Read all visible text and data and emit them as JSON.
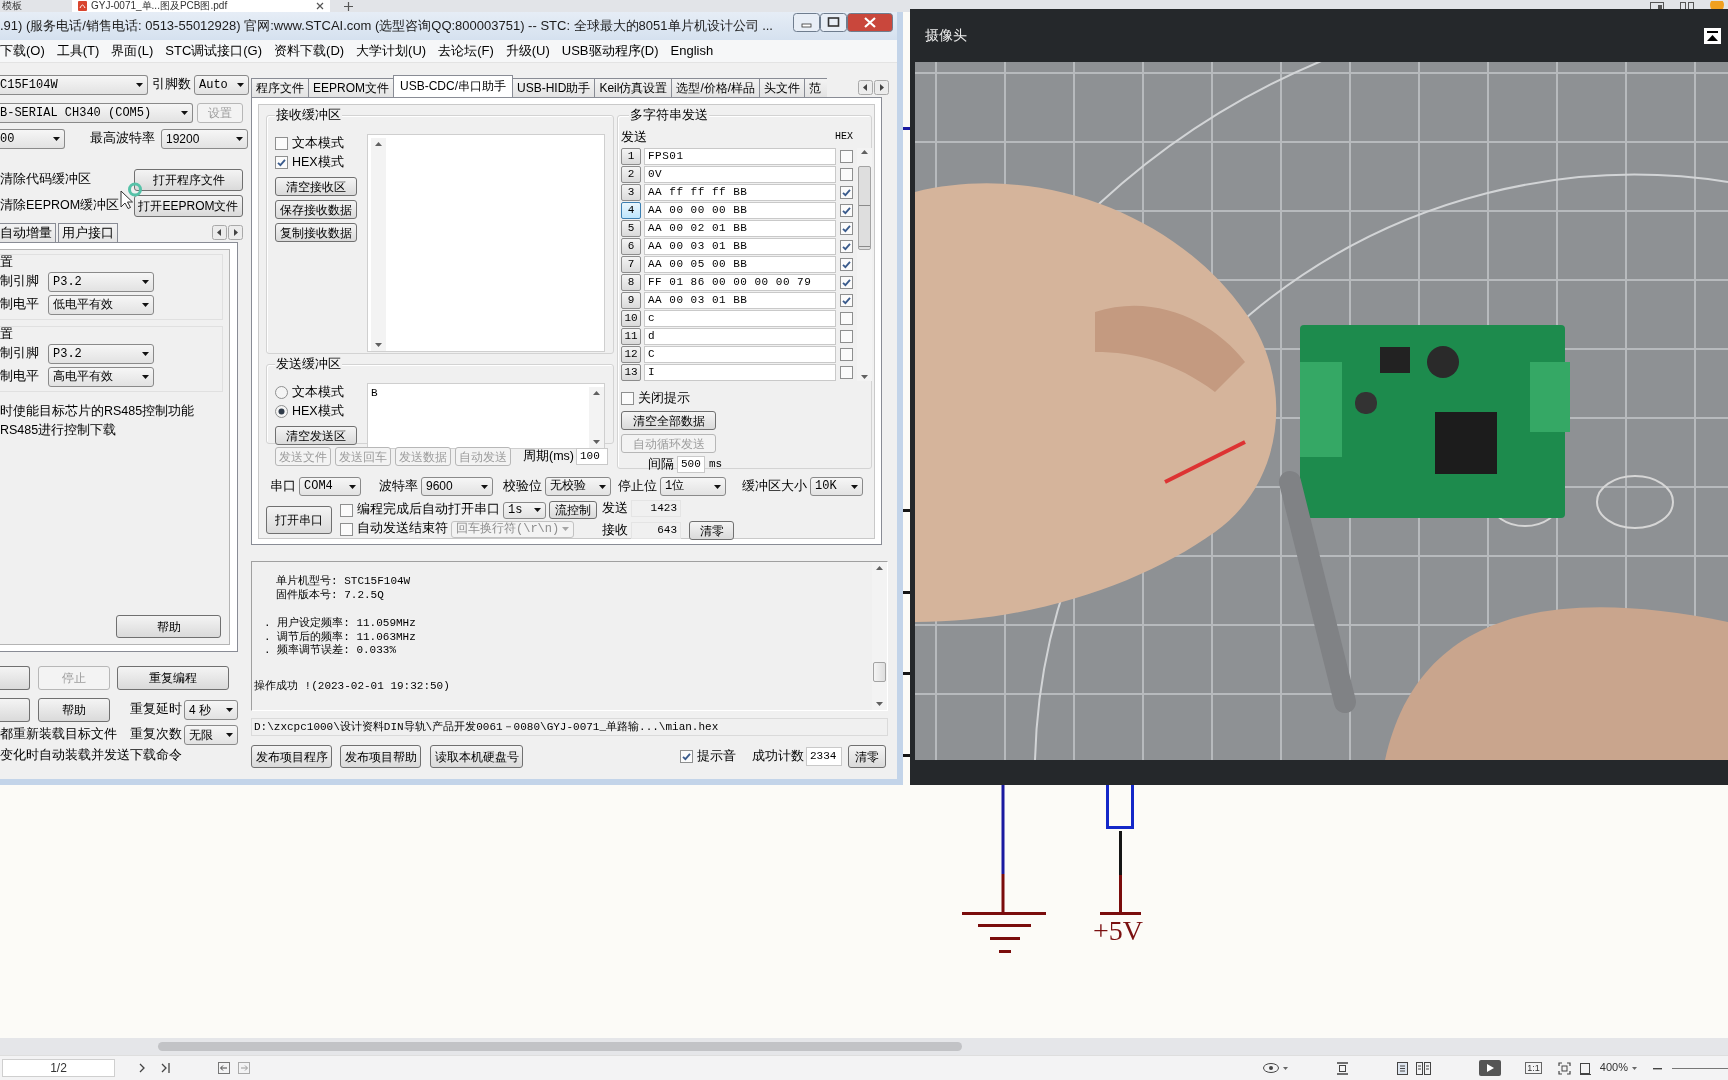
{
  "browser_tabs": [
    {
      "label": "模板",
      "selected": false
    },
    {
      "label": "GYJ-0071_单...图及PCB图.pdf",
      "selected": true
    }
  ],
  "stc_window": {
    "title": ".91) (服务电话/销售电话: 0513-55012928) 官网:www.STCAI.com  (选型咨询QQ:800003751) -- STC: 全球最大的8051单片机设计公司 ...",
    "menu": [
      "下载(O)",
      "工具(T)",
      "界面(L)",
      "STC调试接口(G)",
      "资料下载(D)",
      "大学计划(U)",
      "去论坛(F)",
      "升级(U)",
      "USB驱动程序(D)",
      "English"
    ],
    "chip": "C15F104W",
    "pin_count_label": "引脚数",
    "pin_count": "Auto",
    "port": "B-SERIAL CH340 (COM5)",
    "port_settings": {
      "label": "设置",
      "disabled": true
    },
    "min_baud": "00",
    "max_baud_label": "最高波特率",
    "max_baud": "19200",
    "buffers": [
      {
        "label": "清除代码缓冲区",
        "button": "打开程序文件"
      },
      {
        "label": "清除EEPROM缓冲区",
        "button": "打开EEPROM文件"
      }
    ],
    "option_tabs": [
      {
        "label": "自动增量",
        "selected": false
      },
      {
        "label": "用户接口",
        "selected": false
      }
    ],
    "control_groups": [
      {
        "title": "置",
        "rows": [
          {
            "label": "制引脚",
            "value": "P3.2"
          },
          {
            "label": "制电平",
            "value": "低电平有效"
          }
        ]
      },
      {
        "title": "置",
        "rows": [
          {
            "label": "制引脚",
            "value": "P3.2"
          },
          {
            "label": "制电平",
            "value": "高电平有效"
          }
        ]
      }
    ],
    "notes": [
      "时使能目标芯片的RS485控制功能",
      "RS485进行控制下载"
    ],
    "help_button": "帮助",
    "action_buttons": [
      {
        "disabled": false
      },
      {
        "label": "停止",
        "disabled": true
      },
      {
        "label": "重复编程",
        "disabled": false
      },
      {
        "disabled": false
      },
      {
        "label": "帮助",
        "disabled": false
      }
    ],
    "repeat_delay_label": "重复延时",
    "repeat_delay": "4 秒",
    "reload_note": "都重新装载目标文件",
    "repeat_count_label": "重复次数",
    "repeat_count": "无限",
    "auto_load_note": "变化时自动装载并发送下载命令",
    "tabs": [
      {
        "label": "程序文件",
        "selected": false
      },
      {
        "label": "EEPROM文件",
        "selected": false
      },
      {
        "label": "USB-CDC/串口助手",
        "selected": true
      },
      {
        "label": "USB-HID助手",
        "selected": false
      },
      {
        "label": "Keil仿真设置",
        "selected": false
      },
      {
        "label": "选型/价格/样品",
        "selected": false
      },
      {
        "label": "头文件",
        "selected": false
      },
      {
        "label": "范",
        "selected": false
      }
    ],
    "receive": {
      "title": "接收缓冲区",
      "modes": [
        {
          "label": "文本模式",
          "checked": false
        },
        {
          "label": "HEX模式",
          "checked": true
        }
      ],
      "buttons": [
        "清空接收区",
        "保存接收数据",
        "复制接收数据"
      ]
    },
    "send": {
      "title": "发送缓冲区",
      "modes": [
        {
          "label": "文本模式",
          "selected": false
        },
        {
          "label": "HEX模式",
          "selected": true
        }
      ],
      "clear_button": "清空发送区",
      "value": "B"
    },
    "send_buttons": [
      {
        "label": "发送文件",
        "disabled": true
      },
      {
        "label": "发送回车",
        "disabled": true
      },
      {
        "label": "发送数据",
        "disabled": true
      },
      {
        "label": "自动发送",
        "disabled": true
      }
    ],
    "period_label": "周期(ms)",
    "period": "100",
    "multi_send": {
      "title": "多字符串发送",
      "send_header": "发送",
      "hex_header": "HEX",
      "rows": [
        {
          "number": "1",
          "text": "FPS01",
          "hex": false,
          "selected": false
        },
        {
          "number": "2",
          "text": "0V",
          "hex": false,
          "selected": false
        },
        {
          "number": "3",
          "text": "AA ff ff ff BB",
          "hex": true,
          "selected": false
        },
        {
          "number": "4",
          "text": "AA 00 00 00 BB",
          "hex": true,
          "selected": true
        },
        {
          "number": "5",
          "text": "AA 00 02 01 BB",
          "hex": true,
          "selected": false
        },
        {
          "number": "6",
          "text": "AA 00 03 01 BB",
          "hex": true,
          "selected": false
        },
        {
          "number": "7",
          "text": "AA 00 05 00 BB",
          "hex": true,
          "selected": false
        },
        {
          "number": "8",
          "text": "FF 01 86 00 00 00 00 79",
          "hex": true,
          "selected": false
        },
        {
          "number": "9",
          "text": "AA 00 03 01 BB",
          "hex": true,
          "selected": false
        },
        {
          "number": "10",
          "text": "c",
          "hex": false,
          "selected": false
        },
        {
          "number": "11",
          "text": "d",
          "hex": false,
          "selected": false
        },
        {
          "number": "12",
          "text": "C",
          "hex": false,
          "selected": false
        },
        {
          "number": "13",
          "text": "I",
          "hex": false,
          "selected": false
        }
      ],
      "close_hint": {
        "label": "关闭提示",
        "checked": false
      },
      "buttons": [
        {
          "label": "清空全部数据",
          "disabled": false
        },
        {
          "label": "自动循环发送",
          "disabled": true
        }
      ],
      "interval_label": "间隔",
      "interval": "500",
      "interval_unit": "ms"
    },
    "serial": {
      "settings": [
        {
          "label": "串口",
          "value": "COM4"
        },
        {
          "label": "波特率",
          "value": "9600"
        },
        {
          "label": "校验位",
          "value": "无校验"
        },
        {
          "label": "停止位",
          "value": "1位"
        },
        {
          "label": "缓冲区大小",
          "value": "10K"
        }
      ],
      "open_button": "打开串口",
      "auto_open": {
        "label": "编程完成后自动打开串口",
        "checked": false
      },
      "auto_open_delay": "1s",
      "flow_button": "流控制",
      "auto_end": {
        "label": "自动发送结束符",
        "checked": false
      },
      "end_char": {
        "value": "回车换行符(\\r\\n)",
        "disabled": true
      },
      "counters": [
        {
          "label": "发送",
          "value": "1423"
        },
        {
          "label": "接收",
          "value": "643"
        }
      ],
      "clear_button": "清零"
    },
    "log": [
      [
        "单片机型号: STC15F104W",
        "固件版本号: 7.2.5Q"
      ],
      [
        ". 用户设定频率: 11.059MHz",
        ". 调节后的频率: 11.063MHz",
        ". 频率调节误差: 0.033%"
      ],
      [
        "操作成功 !(2023-02-01 19:32:50)"
      ]
    ],
    "path": "D:\\zxcpc1000\\设计资料DIN导轨\\产品开发0061－0080\\GYJ-0071_单路输...\\mian.hex",
    "footer": {
      "buttons": [
        "发布项目程序",
        "发布项目帮助",
        "读取本机硬盘号"
      ],
      "beep": {
        "label": "提示音",
        "checked": true
      },
      "count_label": "成功计数",
      "count": "2334",
      "clear_button": "清零"
    }
  },
  "camera_window": {
    "title": "摄像头"
  },
  "schematic": {
    "power_label": "+5V"
  },
  "status_bar": {
    "page": "1/2",
    "actual_size": "1:1",
    "zoom": "400%"
  }
}
